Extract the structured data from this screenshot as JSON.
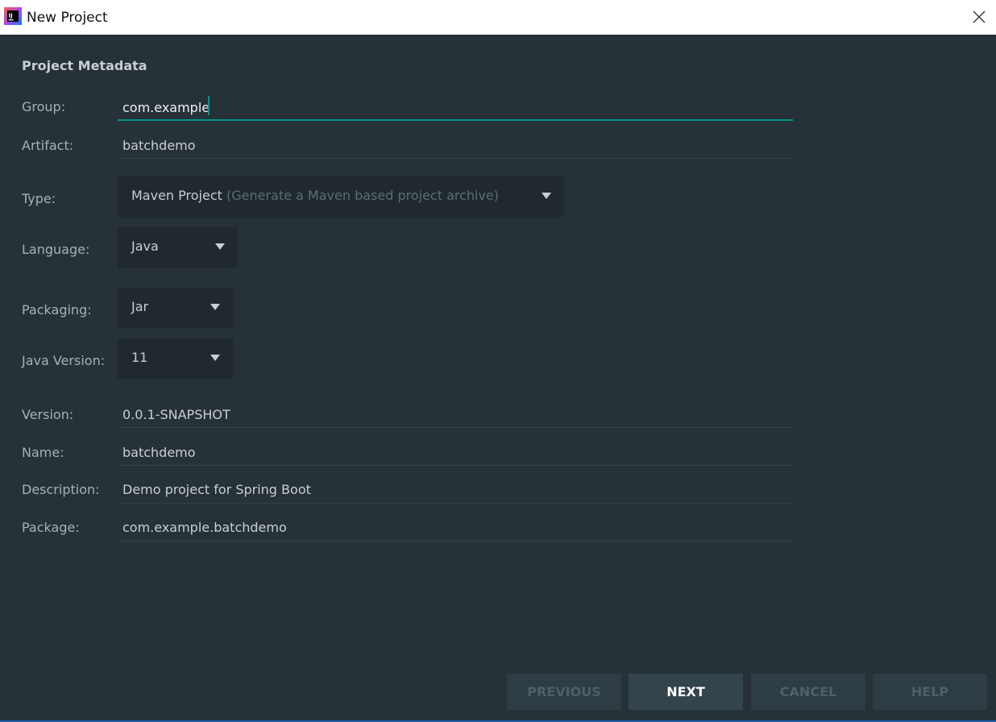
{
  "window": {
    "title": "New Project",
    "icon": "intellij-idea-icon",
    "close_icon": "close-icon"
  },
  "section_title": "Project Metadata",
  "fields": {
    "group": {
      "label": "Group:",
      "value": "com.example"
    },
    "artifact": {
      "label": "Artifact:",
      "value": "batchdemo"
    },
    "type": {
      "label": "Type:",
      "value": "Maven Project",
      "hint": "(Generate a Maven based project archive)"
    },
    "language": {
      "label": "Language:",
      "value": "Java"
    },
    "packaging": {
      "label": "Packaging:",
      "value": "Jar"
    },
    "java_version": {
      "label": "Java Version:",
      "value": "11"
    },
    "version": {
      "label": "Version:",
      "value": "0.0.1-SNAPSHOT"
    },
    "name": {
      "label": "Name:",
      "value": "batchdemo"
    },
    "description": {
      "label": "Description:",
      "value": "Demo project for Spring Boot"
    },
    "package": {
      "label": "Package:",
      "value": "com.example.batchdemo"
    }
  },
  "buttons": {
    "previous": "PREVIOUS",
    "next": "NEXT",
    "cancel": "CANCEL",
    "help": "HELP"
  },
  "colors": {
    "background": "#263238",
    "accent": "#009688",
    "titlebar": "#ffffff"
  }
}
